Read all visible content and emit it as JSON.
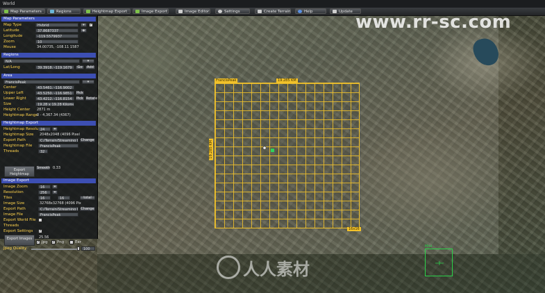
{
  "window": {
    "title": "World"
  },
  "toolbar": [
    {
      "label": "Map Parameters",
      "icon": "map-icon",
      "color": "#7fc24b"
    },
    {
      "label": "Regions",
      "icon": "regions-icon",
      "color": "#6bb7d8"
    },
    {
      "label": "Heightmap Export",
      "icon": "heightmap-icon",
      "color": "#7fc24b"
    },
    {
      "label": "Image Export",
      "icon": "image-icon",
      "color": "#7fc24b"
    },
    {
      "label": "Image Editor",
      "icon": "editor-icon",
      "color": "#cfcfcf"
    },
    {
      "label": "Settings",
      "icon": "gear-icon",
      "color": "#cfcfcf"
    },
    {
      "label": "Create Terrain",
      "icon": "terrain-icon",
      "color": "#cfcfcf"
    },
    {
      "label": "Help",
      "icon": "help-icon",
      "color": "#5a8fe0"
    },
    {
      "label": "Update",
      "icon": "update-icon",
      "color": "#cfcfcf"
    }
  ],
  "panel": {
    "map_params": {
      "header": "Map Parameters",
      "map_type_label": "Map Type",
      "map_type_value": "Hybrid",
      "latitude_label": "Latitude",
      "latitude_value": "37.8687337",
      "longitude_label": "Longitude",
      "longitude_value": "-119.5579937",
      "zoom_label": "Zoom",
      "zoom_value": "10",
      "mouse_label": "Mouse",
      "mouse_value": "34.00735, -108.11 1587"
    },
    "regions": {
      "header": "Regions",
      "dropdown_value": "N/A",
      "latlong_label": "Lat/Long",
      "latlong_value": "39.3918, -119.1679",
      "go_label": "Go",
      "add_label": "Add"
    },
    "heightmap_area": {
      "header": "Area",
      "dropdown_value": "FrancisPeak",
      "center_label": "Center",
      "center_value": "43.5461, -116.9002",
      "upper_left_label": "Upper Left",
      "upper_left_value": "43.5250, -116.9851",
      "lower_right_label": "Lower Right",
      "lower_right_value": "43.4212, -116.8154",
      "size_label": "Size",
      "size_value": "19.28 x 19.28 Kilometers",
      "height_center_label": "Height Center",
      "height_center_value": "2871 m",
      "height_range_label": "Heightmap Range",
      "height_range_value": "0 - 4,367.34 (4367)",
      "pick_label": "Pick",
      "rotate_label": "Rotate"
    },
    "heightmap_export": {
      "header": "Heightmap Export",
      "resolution_label": "Heightmap Resolution",
      "resolution_value": "24",
      "size_label": "Heightmap Size",
      "size_value": "2048x2048 (4096 Pixels)",
      "path_label": "Export Path",
      "path_value": "C:/Terrain/Streaming Exe",
      "file_label": "Heightmap File",
      "file_value": "FrancisPeak",
      "threads_label": "Threads",
      "threads_value": "32",
      "export_button": "Export Heightmap",
      "smooth_label": "Smooth",
      "smooth_value": "0.33",
      "change_label": "Change"
    },
    "image_export": {
      "header": "Image Export",
      "image_zoom_label": "Image Zoom",
      "image_zoom_value": "16",
      "resolution_label": "Resolution",
      "resolution_value": "256",
      "tiles_label": "Tiles",
      "tiles_x": "16",
      "tiles_y": "16",
      "tiles_unit": "total",
      "image_size_label": "Image Size",
      "image_size_value": "32768x32768 (4096 Pixels)",
      "path_label": "Export Path",
      "path_value": "C:/Terrain/Streaming Exe",
      "file_label": "Image File",
      "file_value": "FrancisPeak",
      "world_file_label": "Export World File",
      "threads_label": "Threads",
      "settings_label": "Export Settings",
      "export_button": "Export Images",
      "jpg_label": "Jpg",
      "png_label": "Png",
      "exr_label": "Exr",
      "quality_label": "Jpeg Quality",
      "quality_value": "100",
      "change_label": "Change",
      "ratio_value": "25.56"
    }
  },
  "map": {
    "grid_label": "FrancisPeak",
    "grid_size_top": "19.285 KM",
    "grid_size_side": "19.285 KM",
    "grid_corner": "16x16",
    "grid_cols": 16,
    "grid_rows": 16,
    "green_label": "Mini"
  },
  "watermark": {
    "url": "www.rr-sc.com",
    "cn": "人人素材"
  }
}
